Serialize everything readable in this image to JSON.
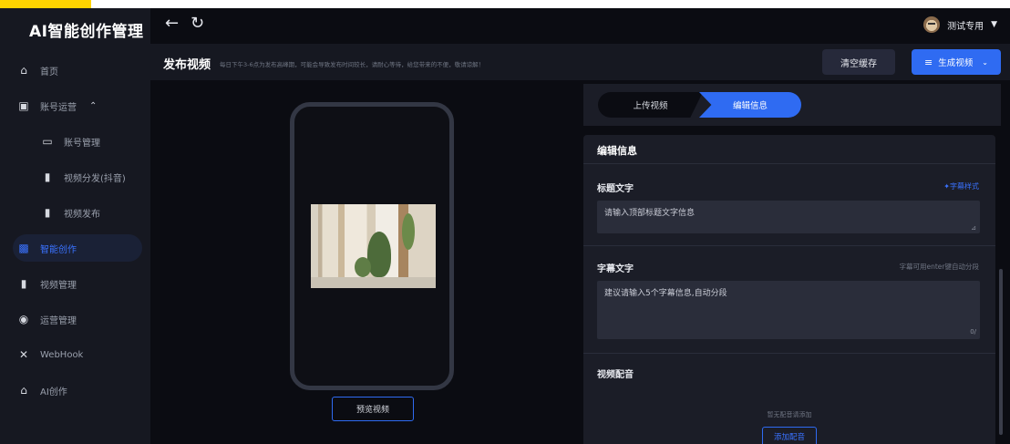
{
  "app": {
    "title": "AI智能创作管理"
  },
  "sidebar": {
    "items": [
      {
        "label": "首页",
        "icon": "home-icon"
      },
      {
        "label": "账号运营",
        "icon": "chart-icon"
      },
      {
        "label": "账号管理",
        "icon": "monitor-icon"
      },
      {
        "label": "视频分发(抖音)",
        "icon": "video-icon"
      },
      {
        "label": "视频发布",
        "icon": "video-icon"
      },
      {
        "label": "智能创作",
        "icon": "robot-icon"
      },
      {
        "label": "视频管理",
        "icon": "video-icon"
      },
      {
        "label": "运营管理",
        "icon": "trophy-icon"
      },
      {
        "label": "WebHook",
        "icon": "shuffle-icon"
      },
      {
        "label": "AI创作",
        "icon": "home-icon"
      }
    ]
  },
  "header": {
    "user_name": "测试专用"
  },
  "page": {
    "title": "发布视频",
    "notice": "每日下午3-6点为发布高峰期，可能会导致发布时间较长，请耐心等待，给您带来的不便，敬请谅解！",
    "clear_cache_label": "清空缓存",
    "generate_label": "生成视频"
  },
  "preview": {
    "button_label": "预览视频"
  },
  "steps": {
    "step1": "上传视频",
    "step2": "编辑信息"
  },
  "form": {
    "section_title": "编辑信息",
    "title_label": "标题文字",
    "title_style_link": "字幕样式",
    "title_placeholder": "请输入顶部标题文字信息",
    "subtitle_label": "字幕文字",
    "subtitle_hint": "字幕可用enter键自动分段",
    "subtitle_placeholder": "建议请输入5个字幕信息,自动分段",
    "subtitle_counter": "0/",
    "dubbing_label": "视频配音",
    "dubbing_empty": "暂无配音请添加",
    "add_dubbing_label": "添加配音"
  },
  "colors": {
    "accent": "#2f6bf2",
    "background": "#0b0c12",
    "panel": "#1b1d27"
  }
}
